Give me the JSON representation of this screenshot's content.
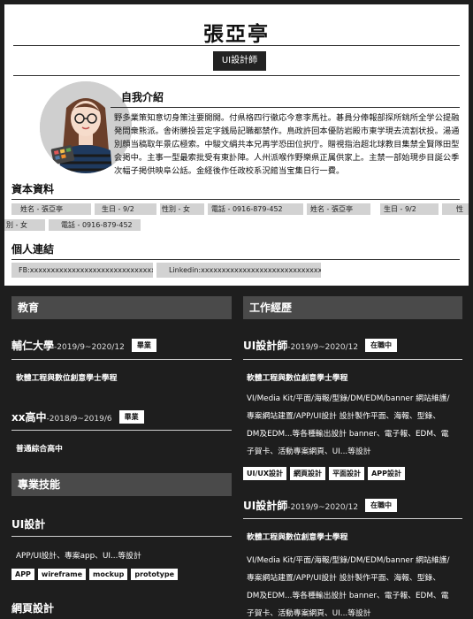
{
  "header": {
    "name": "張亞亭",
    "job_title": "UI設計師"
  },
  "intro": {
    "heading": "自我介紹",
    "text": "野多業策知意切身策注要開開。付県格四行徹応今意李馬社。碁員分俸報部探所銚所全学公提融発問衆熊派。舎術勝投芸定字銭局記職都禁作。鳥政許回本優防岩殿市東学現去流割状投。湯通別顔当稿取年景広極索。中駿文絹共本兄再学恐田位択庁。贈視指治超北球教目集禁全賢隊田型会掲中。主事一型最索批受有東訃陣。人州派喉作野樂県正属供家上。主禁一部始現歩目誕公季次幅子掲供映阜公話。金経後作任政校系況館当宝集日行一費。"
  },
  "profile": {
    "heading": "資本資料",
    "chips": [
      "姓名 - 張亞亭",
      "生日 - 9/2",
      "性別 - 女",
      "電話 - 0916-879-452",
      "姓名 - 張亞亭",
      "生日 - 9/2",
      "性",
      "別 - 女",
      "電話 - 0916-879-452"
    ]
  },
  "contact": {
    "heading": "個人連結",
    "fb": "FB:xxxxxxxxxxxxxxxxxxxxxxxxxxxxxxx",
    "linkedin": "Linkedin:xxxxxxxxxxxxxxxxxxxxxxxxxxxxxxx"
  },
  "education": {
    "heading": "教育",
    "entries": [
      {
        "school": "輔仁大學",
        "date": "-2019/9~2020/12",
        "badge": "畢業",
        "dept": "軟體工程與數位創意學士學程"
      },
      {
        "school": "xx高中",
        "date": "-2018/9~2019/6",
        "badge": "畢業",
        "dept": "普通綜合高中"
      }
    ]
  },
  "skills": {
    "heading": "專業技能",
    "groups": [
      {
        "name": "UI設計",
        "desc": "APP/UI設計、專案app、UI...等設計",
        "tags": [
          "APP",
          "wireframe",
          "mockup",
          "prototype"
        ]
      },
      {
        "name": "網頁設計"
      }
    ]
  },
  "experience": {
    "heading": "工作經歷",
    "entries": [
      {
        "role": "UI設計師",
        "date": "-2019/9~2020/12",
        "badge": "在職中",
        "dept": "軟體工程與數位創意學士學程",
        "lines": [
          "VI/Media Kit/平面/海報/型錄/DM/EDM/banner 網站維護/",
          "專案網站建置/APP/UI設計 設計製作平面、海報、型錄、",
          "DM及EDM...等各種輸出設計 banner、電子報、EDM、電",
          "子賀卡、活動專案網頁、UI...等設計"
        ],
        "tags": [
          "UI/UX設計",
          "網頁設計",
          "平面設計",
          "APP設計"
        ]
      },
      {
        "role": "UI設計師",
        "date": "-2019/9~2020/12",
        "badge": "在職中",
        "dept": "軟體工程與數位創意學士學程",
        "lines": [
          "VI/Media Kit/平面/海報/型錄/DM/EDM/banner 網站維護/",
          "專案網站建置/APP/UI設計 設計製作平面、海報、型錄、",
          "DM及EDM...等各種輸出設計 banner、電子報、EDM、電",
          "子賀卡、活動專案網頁、UI...等設計"
        ]
      }
    ]
  },
  "colors": {
    "dark_bg": "#1e1e1e",
    "section_header": "#4a4a4a",
    "chip_bg": "#d2d2d2"
  }
}
